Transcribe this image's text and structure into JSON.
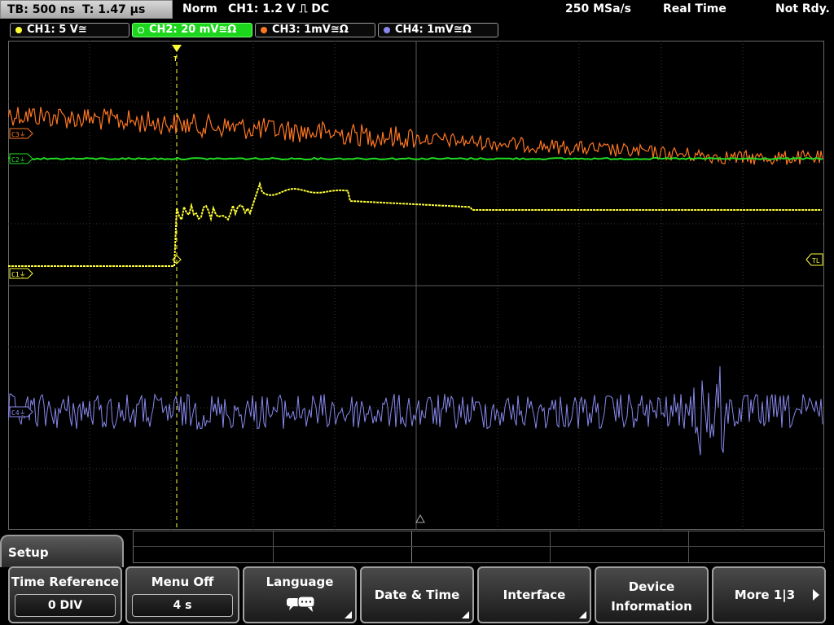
{
  "status_bar": {
    "timebase": "TB: 500 ns",
    "trigger_time": "T: 1.47 µs",
    "trigger_mode": "Norm",
    "trigger_info": "CH1: 1.2 V ⎍ DC",
    "sample_rate": "250 MSa/s",
    "acq_mode": "Real Time",
    "status": "Not Rdy."
  },
  "channels": [
    {
      "label": "CH1: 5 V≅",
      "color": "#ffff33",
      "active": false
    },
    {
      "label": "CH2: 20 mV≅Ω",
      "color": "#22dd22",
      "active": true
    },
    {
      "label": "CH3: 1mV≅Ω",
      "color": "#ff7722",
      "active": false
    },
    {
      "label": "CH4: 1mV≅Ω",
      "color": "#8888ee",
      "active": false
    }
  ],
  "markers": {
    "c3": "C3⏚",
    "c2": "C2⏚",
    "c1": "C1⏚",
    "c4": "C4⏚",
    "tl": "TL",
    "trigger": "T"
  },
  "menu": {
    "title": "Setup",
    "softkeys": [
      {
        "label": "Time Reference",
        "value": "0 DIV"
      },
      {
        "label": "Menu Off",
        "value": "4 s"
      },
      {
        "label": "Language",
        "icon": "speech-bubbles-icon"
      },
      {
        "label": "Date & Time"
      },
      {
        "label": "Interface"
      },
      {
        "label": "Device",
        "label2": "Information"
      },
      {
        "label": "More 1|3"
      }
    ]
  }
}
